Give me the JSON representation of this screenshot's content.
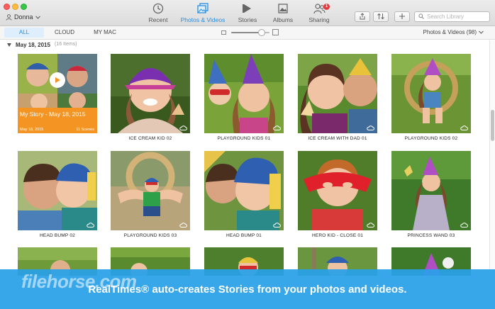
{
  "account": {
    "name": "Donna"
  },
  "nav": [
    {
      "id": "recent",
      "label": "Recent",
      "icon": "clock-icon"
    },
    {
      "id": "photos",
      "label": "Photos & Videos",
      "icon": "photos-icon",
      "active": true
    },
    {
      "id": "stories",
      "label": "Stories",
      "icon": "stories-icon"
    },
    {
      "id": "albums",
      "label": "Albums",
      "icon": "albums-icon"
    },
    {
      "id": "sharing",
      "label": "Sharing",
      "icon": "sharing-icon",
      "badge": "1"
    }
  ],
  "toolbar": {
    "search_placeholder": "Search Library"
  },
  "filters": {
    "tabs": [
      {
        "label": "ALL",
        "active": true
      },
      {
        "label": "CLOUD"
      },
      {
        "label": "MY MAC"
      }
    ],
    "type_select": "Photos & Videos (98)"
  },
  "thumbnail_size": 0.8,
  "section": {
    "date": "May 18, 2015",
    "count": "(16 Items)"
  },
  "story": {
    "title": "My Story - May 18, 2015",
    "date": "May 18, 2015",
    "duration": "11 Scenes"
  },
  "items": [
    {
      "label": ""
    },
    {
      "label": "ICE CREAM KID 02"
    },
    {
      "label": "PLAYGROUND KIDS 01"
    },
    {
      "label": "ICE CREAM WITH DAD 01"
    },
    {
      "label": "PLAYGROUND KIDS 02"
    },
    {
      "label": "HEAD BUMP 02"
    },
    {
      "label": "PLAYGROUND KIDS 03"
    },
    {
      "label": "HEAD BUMP 01"
    },
    {
      "label": "HERO KID - CLOSE 01"
    },
    {
      "label": "PRINCESS WAND 03"
    },
    {
      "label": ""
    },
    {
      "label": ""
    },
    {
      "label": ""
    },
    {
      "label": ""
    },
    {
      "label": ""
    }
  ],
  "promo": {
    "text": "RealTimes® auto-creates Stories from your photos and videos.",
    "watermark": "filehorse.com"
  },
  "colors": {
    "accent": "#2a8fe0",
    "story_banner": "#f39423",
    "promo": "#28a0e8",
    "badge": "#e8383d"
  }
}
